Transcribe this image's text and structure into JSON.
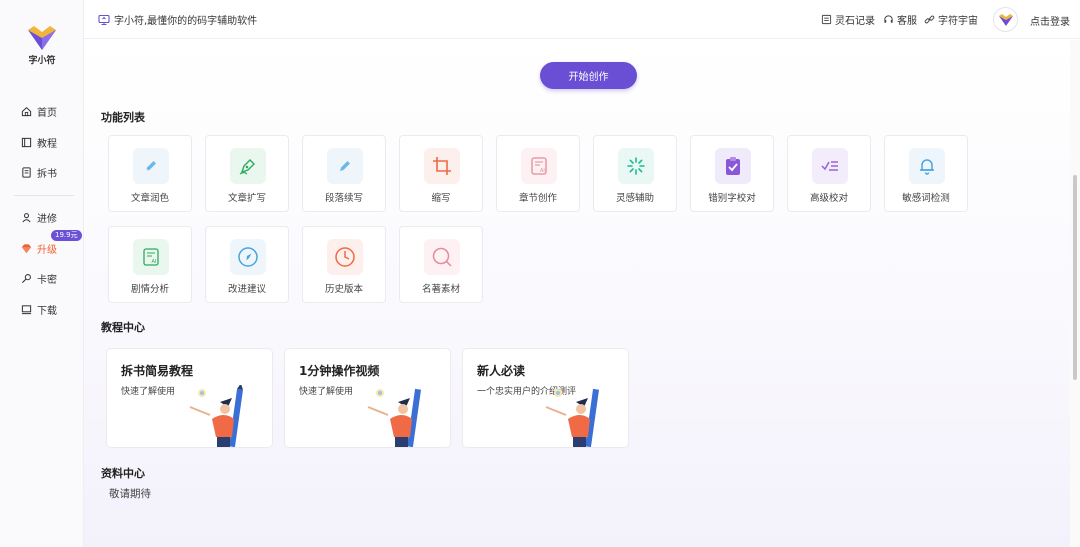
{
  "app": {
    "name": "字小符",
    "tagline": "字小符,最懂你的的码字辅助软件"
  },
  "sidebar": {
    "items": [
      {
        "label": "首页",
        "icon": "home-icon"
      },
      {
        "label": "教程",
        "icon": "book-icon"
      },
      {
        "label": "拆书",
        "icon": "document-icon"
      },
      {
        "label": "进修",
        "icon": "study-icon"
      },
      {
        "label": "升级",
        "icon": "diamond-icon",
        "badge": "19.9元"
      },
      {
        "label": "卡密",
        "icon": "key-icon"
      },
      {
        "label": "下载",
        "icon": "download-icon"
      }
    ]
  },
  "header": {
    "links": [
      {
        "label": "灵石记录",
        "icon": "record-icon"
      },
      {
        "label": "客服",
        "icon": "headset-icon"
      },
      {
        "label": "字符宇宙",
        "icon": "link-icon"
      }
    ],
    "login": "点击登录"
  },
  "main": {
    "start_button": "开始创作",
    "features_title": "功能列表",
    "features": [
      {
        "label": "文章润色",
        "icon": "pen-icon",
        "bg": "#eef6fc",
        "color": "#4aa3e0"
      },
      {
        "label": "文章扩写",
        "icon": "fountain-pen-icon",
        "bg": "#eaf7ef",
        "color": "#2eaa5e"
      },
      {
        "label": "段落续写",
        "icon": "pen-icon",
        "bg": "#eef6fc",
        "color": "#4aa3e0"
      },
      {
        "label": "缩写",
        "icon": "crop-icon",
        "bg": "#fdf0ec",
        "color": "#ef6a45"
      },
      {
        "label": "章节创作",
        "icon": "ai-document-icon",
        "bg": "#fdf1f3",
        "color": "#e58b9c"
      },
      {
        "label": "灵感辅助",
        "icon": "loading-icon",
        "bg": "#e9f8f4",
        "color": "#1fb98f"
      },
      {
        "label": "错别字校对",
        "icon": "clipboard-check-icon",
        "bg": "#f0ebfb",
        "color": "#8a57d8"
      },
      {
        "label": "高级校对",
        "icon": "check-list-icon",
        "bg": "#f3ecfb",
        "color": "#9b63d8"
      },
      {
        "label": "敏感词检测",
        "icon": "bell-icon",
        "bg": "#eef6fc",
        "color": "#4aa3e0"
      },
      {
        "label": "剧情分析",
        "icon": "ai-document-icon",
        "bg": "#eaf7ef",
        "color": "#2eaa5e"
      },
      {
        "label": "改进建议",
        "icon": "compass-icon",
        "bg": "#eef6fc",
        "color": "#4aa3e0"
      },
      {
        "label": "历史版本",
        "icon": "clock-icon",
        "bg": "#fdf0ec",
        "color": "#ef6a45"
      },
      {
        "label": "名著素材",
        "icon": "search-icon",
        "bg": "#fdf1f3",
        "color": "#e58b9c"
      }
    ],
    "tutorials_title": "教程中心",
    "tutorials": [
      {
        "title": "拆书简易教程",
        "subtitle": "快速了解使用"
      },
      {
        "title": "1分钟操作视频",
        "subtitle": "快速了解使用"
      },
      {
        "title": "新人必读",
        "subtitle": "一个忠实用户的介绍测评"
      }
    ],
    "resources_title": "资料中心",
    "resources_placeholder": "敬请期待"
  },
  "colors": {
    "accent": "#6a4fd4",
    "active": "#f0602d"
  }
}
